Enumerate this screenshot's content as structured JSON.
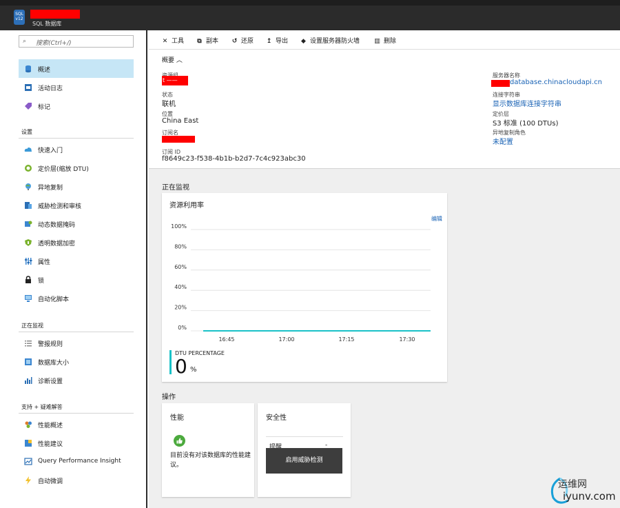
{
  "header": {
    "logo_text": "SQL v12",
    "subtitle": "SQL 数据库"
  },
  "sidebar": {
    "search_placeholder": "搜索(Ctrl+/)",
    "top_items": [
      {
        "label": "概述",
        "icon": "database-icon",
        "active": true
      },
      {
        "label": "活动日志",
        "icon": "activity-log-icon"
      },
      {
        "label": "标记",
        "icon": "tag-icon"
      }
    ],
    "sections": [
      {
        "title": "设置",
        "items": [
          {
            "label": "快速入门",
            "icon": "cloud-icon"
          },
          {
            "label": "定价层(缩放 DTU)",
            "icon": "gauge-icon"
          },
          {
            "label": "异地复制",
            "icon": "globe-icon"
          },
          {
            "label": "威胁检测和审核",
            "icon": "shield-audit-icon"
          },
          {
            "label": "动态数据掩码",
            "icon": "mask-icon"
          },
          {
            "label": "透明数据加密",
            "icon": "encryption-shield-icon"
          },
          {
            "label": "属性",
            "icon": "properties-icon"
          },
          {
            "label": "锁",
            "icon": "lock-icon"
          },
          {
            "label": "自动化脚本",
            "icon": "script-icon"
          }
        ]
      },
      {
        "title": "正在监视",
        "items": [
          {
            "label": "警报规则",
            "icon": "alert-rules-icon"
          },
          {
            "label": "数据库大小",
            "icon": "database-size-icon"
          },
          {
            "label": "诊断设置",
            "icon": "diagnostics-icon"
          }
        ]
      },
      {
        "title": "支持 + 疑难解答",
        "items": [
          {
            "label": "性能概述",
            "icon": "performance-overview-icon"
          },
          {
            "label": "性能建议",
            "icon": "recommendations-icon"
          },
          {
            "label": "Query Performance Insight",
            "icon": "query-insight-icon"
          },
          {
            "label": "自动微调",
            "icon": "lightning-icon"
          }
        ]
      }
    ]
  },
  "toolbar": {
    "tools": "工具",
    "copy": "副本",
    "restore": "还原",
    "export": "导出",
    "firewall": "设置服务器防火墙",
    "delete": "删除"
  },
  "summary": {
    "header": "概要",
    "resource_group_label": "资源组",
    "resource_group_value": "t ——",
    "status_label": "状态",
    "status_value": "联机",
    "location_label": "位置",
    "location_value": "China East",
    "subscription_name_label": "订阅名",
    "subscription_id_label": "订阅 ID",
    "subscription_id_value": "f8649c23-f538-4b1b-b2d7-7c4c923abc30",
    "server_name_label": "服务器名称",
    "server_name_value": "database.chinacloudapi.cn",
    "connection_string_label": "连接字符串",
    "connection_string_value": "显示数据库连接字符串",
    "pricing_tier_label": "定价层",
    "pricing_tier_value": "S3 标准 (100 DTUs)",
    "geo_replication_label": "异地复制角色",
    "geo_replication_value": "未配置"
  },
  "monitoring": {
    "header": "正在监视",
    "card_title": "资源利用率",
    "edit_label": "编辑",
    "metric_label": "DTU PERCENTAGE",
    "metric_value": "0",
    "metric_unit": "%"
  },
  "chart_data": {
    "type": "line",
    "title": "资源利用率",
    "y_ticks": [
      "100%",
      "80%",
      "60%",
      "40%",
      "20%",
      "0%"
    ],
    "x_ticks": [
      "16:45",
      "17:00",
      "17:15",
      "17:30"
    ],
    "ylim": [
      0,
      100
    ],
    "series": [
      {
        "name": "DTU PERCENTAGE",
        "values": [
          0,
          0,
          0,
          0,
          0
        ],
        "color": "#18c1c7"
      }
    ]
  },
  "operations": {
    "header": "操作",
    "performance_title": "性能",
    "performance_text": "目前没有对该数据库的性能建议。",
    "security_title": "安全性",
    "security_row_label": "提醒",
    "security_row_value": "-",
    "security_button": "启用威胁检测"
  },
  "watermark": {
    "text": "运维网",
    "url": "iyunv.com"
  }
}
